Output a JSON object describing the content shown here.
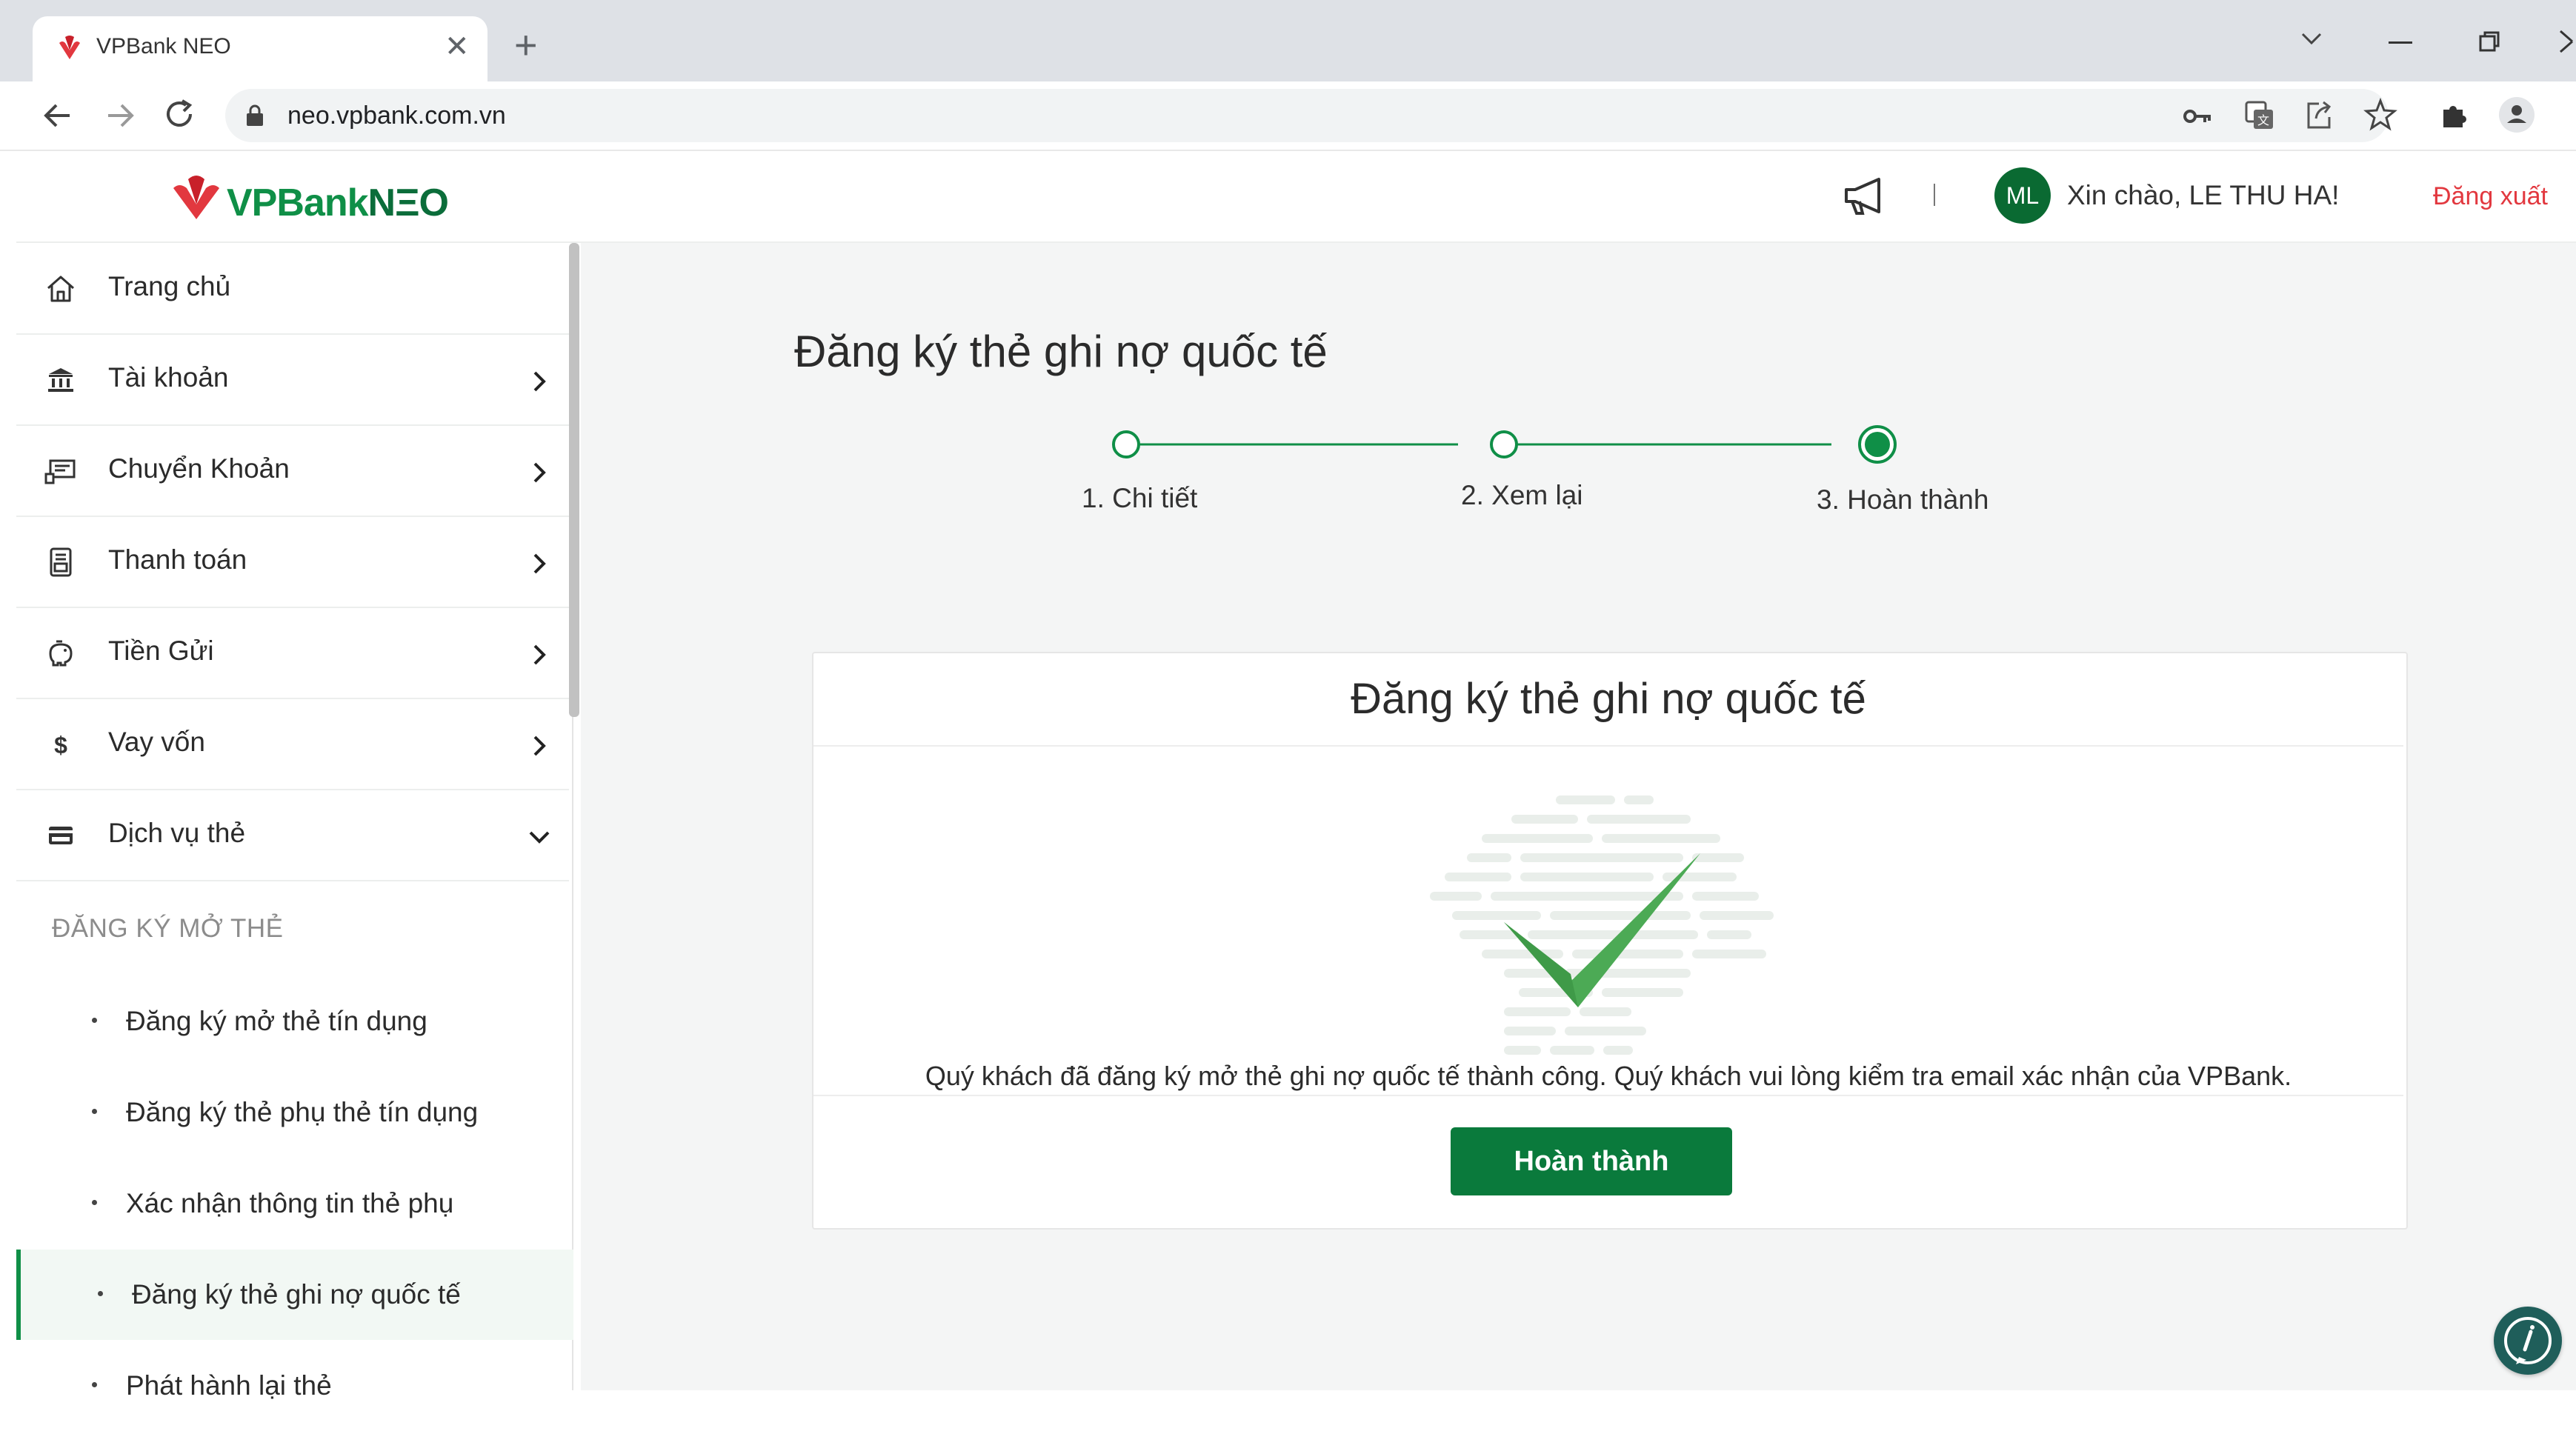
{
  "browser": {
    "tab_title": "VPBank NEO",
    "url": "neo.vpbank.com.vn"
  },
  "header": {
    "logo_vpbank": "VPBank",
    "logo_neo": "NΞO",
    "avatar_initials": "ML",
    "greeting": "Xin chào, LE THU HA!",
    "logout": "Đăng xuất",
    "brand_color": "#0f8f47",
    "logout_color": "#e2383f"
  },
  "sidebar": {
    "items": [
      {
        "label": "Trang chủ",
        "icon": "home-icon"
      },
      {
        "label": "Tài khoản",
        "icon": "bank-icon"
      },
      {
        "label": "Chuyển Khoản",
        "icon": "transfer-icon"
      },
      {
        "label": "Thanh toán",
        "icon": "bill-icon"
      },
      {
        "label": "Tiền Gửi",
        "icon": "piggy-bank-icon"
      },
      {
        "label": "Vay vốn",
        "icon": "dollar-icon"
      },
      {
        "label": "Dịch vụ thẻ",
        "icon": "card-icon"
      }
    ],
    "section_title": "ĐĂNG KÝ MỞ THẺ",
    "sub_items": [
      {
        "label": "Đăng ký mở thẻ tín dụng"
      },
      {
        "label": "Đăng ký thẻ phụ thẻ tín dụng"
      },
      {
        "label": "Xác nhận thông tin thẻ phụ"
      },
      {
        "label": "Đăng ký thẻ ghi nợ quốc tế"
      },
      {
        "label": "Phát hành lại thẻ"
      }
    ]
  },
  "main": {
    "page_title": "Đăng ký thẻ ghi nợ quốc tế",
    "steps": [
      {
        "num": "1.",
        "label": "Chi tiết"
      },
      {
        "num": "2.",
        "label": "Xem lại"
      },
      {
        "num": "3.",
        "label": "Hoàn thành"
      }
    ],
    "card": {
      "title": "Đăng ký thẻ ghi nợ quốc tế",
      "message": "Quý khách đã đăng ký mở thẻ ghi nợ quốc tế thành công. Quý khách vui lòng kiểm tra email xác nhận của VPBank.",
      "button": "Hoàn thành"
    }
  }
}
